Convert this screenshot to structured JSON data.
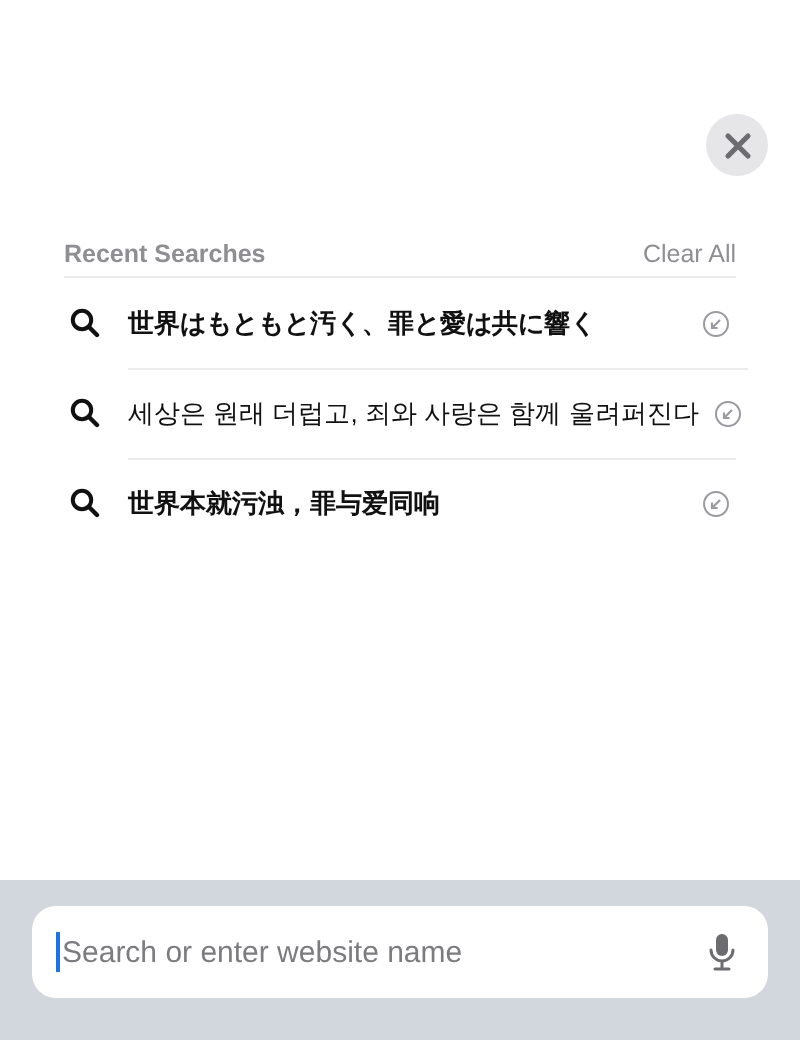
{
  "recent": {
    "title": "Recent Searches",
    "clear": "Clear All"
  },
  "searches": [
    {
      "text": "世界はもともと汚く、罪と愛は共に響く",
      "bold": true
    },
    {
      "text": "세상은 원래 더럽고, 죄와 사랑은 함께 울려퍼진다",
      "bold": false
    },
    {
      "text": "世界本就污浊，罪与爱同响",
      "bold": true
    }
  ],
  "address_bar": {
    "placeholder": "Search or enter website name"
  }
}
